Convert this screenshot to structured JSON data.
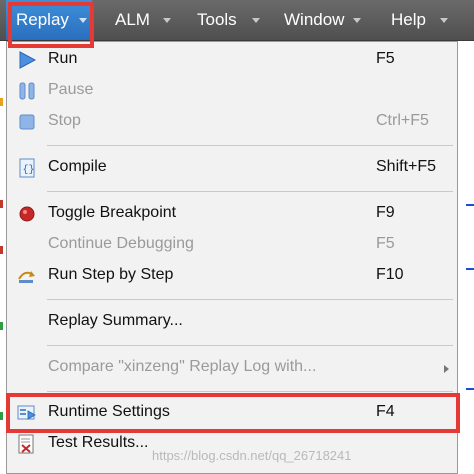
{
  "menubar": {
    "tabs": [
      {
        "label": "Replay",
        "mnemonic_index": 0
      },
      {
        "label": "ALM",
        "mnemonic_index": 0
      },
      {
        "label": "Tools",
        "mnemonic_index": 0
      },
      {
        "label": "Window",
        "mnemonic_index": 0
      },
      {
        "label": "Help",
        "mnemonic_index": 0
      }
    ],
    "active_tab": "Replay"
  },
  "dropdown": {
    "items": [
      {
        "label": "Run",
        "shortcut": "F5",
        "icon": "play-icon",
        "enabled": true
      },
      {
        "label": "Pause",
        "shortcut": "",
        "icon": "pause-icon",
        "enabled": false
      },
      {
        "label": "Stop",
        "shortcut": "Ctrl+F5",
        "icon": "stop-icon",
        "enabled": false
      },
      {
        "label": "Compile",
        "shortcut": "Shift+F5",
        "icon": "compile-icon",
        "enabled": true
      },
      {
        "label": "Toggle Breakpoint",
        "shortcut": "F9",
        "icon": "breakpoint-icon",
        "enabled": true
      },
      {
        "label": "Continue Debugging",
        "shortcut": "F5",
        "icon": "",
        "enabled": false
      },
      {
        "label": "Run Step by Step",
        "shortcut": "F10",
        "icon": "step-icon",
        "enabled": true
      },
      {
        "label": "Replay Summary...",
        "shortcut": "",
        "icon": "",
        "enabled": true
      },
      {
        "label": "Compare \"xinzeng\" Replay Log with...",
        "shortcut": "",
        "icon": "",
        "enabled": false,
        "has_submenu": true
      },
      {
        "label": "Runtime Settings",
        "shortcut": "F4",
        "icon": "runtime-settings-icon",
        "enabled": true,
        "highlighted": true
      },
      {
        "label": "Test Results...",
        "shortcut": "",
        "icon": "test-results-icon",
        "enabled": true
      }
    ]
  },
  "watermark": "https://blog.csdn.net/qq_26718241",
  "colors": {
    "highlight_border": "#e53935",
    "menubar_bg": "#5a5a5a",
    "active_tab": "#2f7fd0",
    "menu_bg": "#f2f2f2",
    "disabled_text": "#9a9a9a"
  }
}
